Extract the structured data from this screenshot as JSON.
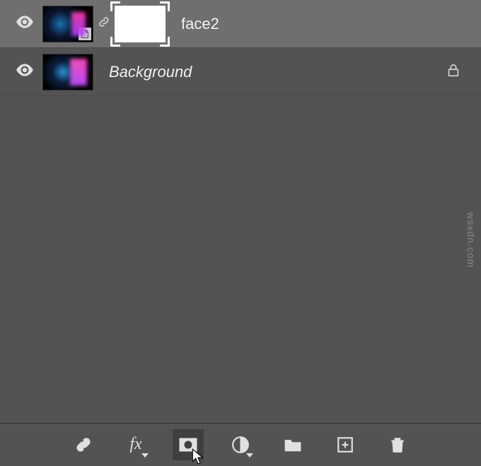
{
  "layers": [
    {
      "name": "face2",
      "selected": true,
      "visible": true,
      "italic": false,
      "smart_object": true,
      "has_mask": true,
      "locked": false
    },
    {
      "name": "Background",
      "selected": false,
      "visible": true,
      "italic": true,
      "smart_object": false,
      "has_mask": false,
      "locked": true
    }
  ],
  "toolbar": {
    "link_label": "Link layers",
    "fx_label": "fx",
    "mask_label": "Add layer mask",
    "adjustment_label": "Create adjustment layer",
    "group_label": "Create group",
    "new_label": "Create new layer",
    "delete_label": "Delete layer"
  },
  "watermark": "wsxdn.com"
}
